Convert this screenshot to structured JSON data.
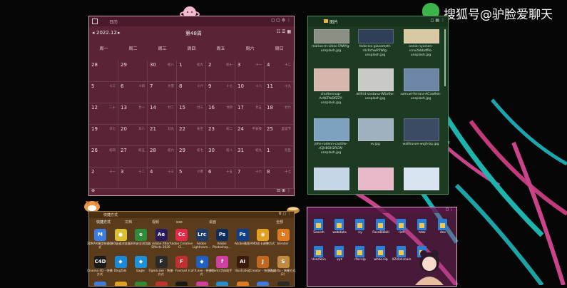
{
  "watermark": {
    "text": "搜狐号@驴脸爱聊天"
  },
  "calendar": {
    "title": "日历",
    "month_label": "2022.12",
    "week_label": "第48周",
    "weekdays": [
      "周一",
      "周二",
      "周三",
      "周四",
      "周五",
      "周六",
      "周日"
    ],
    "rows": [
      [
        {
          "d": "28",
          "l": ""
        },
        {
          "d": "29",
          "l": ""
        },
        {
          "d": "30",
          "l": "初八"
        },
        {
          "d": "1",
          "l": "初九"
        },
        {
          "d": "2",
          "l": "初十"
        },
        {
          "d": "3",
          "l": "十一"
        },
        {
          "d": "4",
          "l": "十二"
        }
      ],
      [
        {
          "d": "5",
          "l": "十三"
        },
        {
          "d": "6",
          "l": "十四"
        },
        {
          "d": "7",
          "l": "大雪"
        },
        {
          "d": "8",
          "l": "十六"
        },
        {
          "d": "9",
          "l": "十七"
        },
        {
          "d": "10",
          "l": "十八"
        },
        {
          "d": "11",
          "l": "十九"
        }
      ],
      [
        {
          "d": "12",
          "l": "二十"
        },
        {
          "d": "13",
          "l": "廿一"
        },
        {
          "d": "14",
          "l": "廿二"
        },
        {
          "d": "15",
          "l": "廿三"
        },
        {
          "d": "16",
          "l": "廿四"
        },
        {
          "d": "17",
          "l": "廿五"
        },
        {
          "d": "18",
          "l": "廿六"
        }
      ],
      [
        {
          "d": "19",
          "l": "廿七"
        },
        {
          "d": "20",
          "l": "廿八"
        },
        {
          "d": "21",
          "l": "廿九"
        },
        {
          "d": "22",
          "l": "冬至"
        },
        {
          "d": "23",
          "l": "初二"
        },
        {
          "d": "24",
          "l": "平安夜"
        },
        {
          "d": "25",
          "l": "圣诞节"
        }
      ],
      [
        {
          "d": "26",
          "l": "初四"
        },
        {
          "d": "27",
          "l": "初五"
        },
        {
          "d": "28",
          "l": "初六"
        },
        {
          "d": "29",
          "l": "初七"
        },
        {
          "d": "30",
          "l": "初八"
        },
        {
          "d": "31",
          "l": "初九"
        },
        {
          "d": "1",
          "l": "元旦"
        }
      ],
      [
        {
          "d": "2",
          "l": "十一"
        },
        {
          "d": "3",
          "l": "十二"
        },
        {
          "d": "4",
          "l": "十三"
        },
        {
          "d": "5",
          "l": "小寒"
        },
        {
          "d": "6",
          "l": "十五"
        },
        {
          "d": "7",
          "l": "十六"
        },
        {
          "d": "8",
          "l": "十七"
        }
      ]
    ]
  },
  "image_folder": {
    "title": "图片",
    "items": [
      {
        "name": "marion-m-vitiec-FAWYg-unsplash.jpg",
        "color": "#8a8f84"
      },
      {
        "name": "federico-giacomett-r4cRchwP5Wlg-unsplash.jpg",
        "color": "#2f3f58"
      },
      {
        "name": "annie-nyarsen-rcnv2bbbdfPo-unsplash.jpg",
        "color": "#d9c9a3"
      },
      {
        "name": "chuttersnap-AcWZYoDfZZY-unsplash.jpg",
        "color": "#d8b6b0"
      },
      {
        "name": "wilfrid-santana-WSv6w-unsplash.jpg",
        "color": "#c8c8c4"
      },
      {
        "name": "samuel-ferrara-ACvw9xk-unsplash.jpg",
        "color": "#6d86a6"
      },
      {
        "name": "john-rodenn-castillo-rCjH8OH2RCW-unsplash.jpg",
        "color": "#7fa1c0"
      },
      {
        "name": "xv.jpg",
        "color": "#9fb0bf"
      },
      {
        "name": "wallhaven-wqjh-bp.jpg",
        "color": "#3c4a63"
      },
      {
        "name": "",
        "color": "#c7d6e6"
      },
      {
        "name": "",
        "color": "#e8b9c8"
      },
      {
        "name": "",
        "color": "#d8e4ef"
      }
    ]
  },
  "shortcuts": {
    "title": "快捷方式",
    "tabs": [
      "快捷方式",
      "文档",
      "视频",
      "exe",
      "桌面",
      "全部"
    ],
    "apps": [
      {
        "name": "3DMAX模型快捷方式",
        "glyph": "M",
        "color": "#3a7ce0"
      },
      {
        "name": "360极速浏览器",
        "glyph": "●",
        "color": "#d8c030"
      },
      {
        "name": "360安全浏览器",
        "glyph": "e",
        "color": "#2f8a3a"
      },
      {
        "name": "Adobe After Effects 2020",
        "glyph": "Ae",
        "color": "#2a1a5e"
      },
      {
        "name": "Adobe Creative Cl...",
        "glyph": "Cc",
        "color": "#e02a48"
      },
      {
        "name": "Adobe Lightroom...",
        "glyph": "Lrc",
        "color": "#1e3b6a"
      },
      {
        "name": "Adobe Photoshop...",
        "glyph": "Ps",
        "color": "#0f2d5a"
      },
      {
        "name": "Adobe美图",
        "glyph": "Ps",
        "color": "#0f3f8a"
      },
      {
        "name": "AMD显卡调整方式",
        "glyph": "◉",
        "color": "#e0a020"
      },
      {
        "name": "blender",
        "glyph": "b",
        "color": "#e07a20"
      },
      {
        "name": "Cinema 4D - 快捷方式",
        "glyph": "C4D",
        "color": "#1a1a1a"
      },
      {
        "name": "DingTalk",
        "glyph": "◆",
        "color": "#1a8ad6"
      },
      {
        "name": "Eagle",
        "glyph": "◆",
        "color": "#1e90d6"
      },
      {
        "name": "Figma.exe - 快捷方式",
        "glyph": "F",
        "color": "#2a2a2a"
      },
      {
        "name": "Foxmail",
        "glyph": "F",
        "color": "#c03030"
      },
      {
        "name": "IcoFX.exe - 快捷方式",
        "glyph": "◆",
        "color": "#2060c0"
      },
      {
        "name": "iFonts字体助手",
        "glyph": "f",
        "color": "#d040a0"
      },
      {
        "name": "Illustrator",
        "glyph": "Ai",
        "color": "#3a1a0a"
      },
      {
        "name": "JCreator - 快捷方式",
        "glyph": "J",
        "color": "#c06820"
      },
      {
        "name": "iSparta - 快捷方式 (2)",
        "glyph": "S",
        "color": "#c08a40"
      }
    ]
  },
  "files": {
    "items": [
      {
        "name": "Search"
      },
      {
        "name": "webdata"
      },
      {
        "name": "ny"
      },
      {
        "name": "FaceBilibili"
      },
      {
        "name": "rich"
      },
      {
        "name": "tdsk"
      },
      {
        "name": "dev"
      },
      {
        "name": "UserSkin"
      },
      {
        "name": "xyz"
      },
      {
        "name": "rfer.zip"
      },
      {
        "name": "whko.zip"
      },
      {
        "name": "XZshd-main"
      },
      {
        "name": ""
      }
    ]
  }
}
